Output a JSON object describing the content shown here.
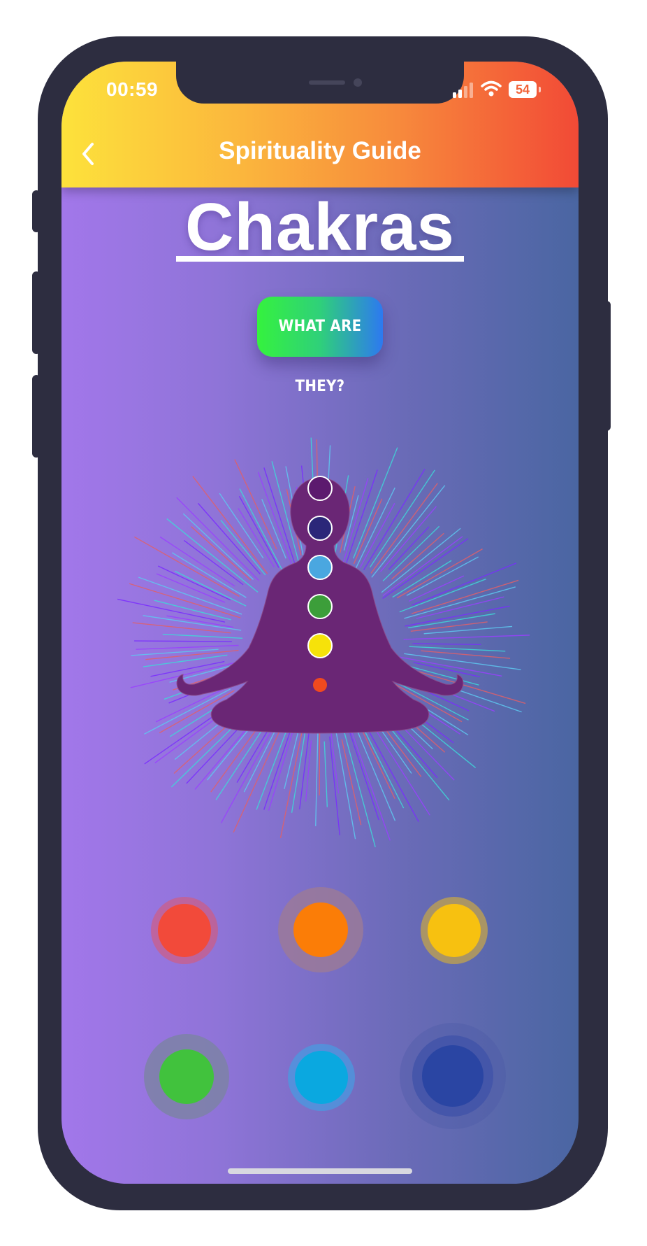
{
  "status_bar": {
    "time": "00:59",
    "battery": "54",
    "signal_icon": "cellular-signal-icon",
    "wifi_icon": "wifi-icon"
  },
  "header": {
    "title": "Spirituality Guide",
    "back_icon": "chevron-left-icon"
  },
  "main": {
    "heading": "Chakras",
    "what_button_label": "WHAT ARE THEY?",
    "figure_chakra_colors": [
      "#5c1a6e",
      "#2b2779",
      "#4aa7e0",
      "#3c9e3a",
      "#f6e20a",
      "#f04a1f"
    ]
  },
  "chakra_buttons": [
    {
      "name": "root",
      "color": "#f24a3a",
      "halo": "#e0566a"
    },
    {
      "name": "sacral",
      "color": "#fb7d07",
      "halo": "#9c7a96"
    },
    {
      "name": "solar-plexus",
      "color": "#f7c110",
      "halo": "#b39a5c"
    },
    {
      "name": "heart",
      "color": "#41c23d",
      "halo": "#7d82a6"
    },
    {
      "name": "throat",
      "color": "#0aa8e0",
      "halo": "#4a9ae0"
    },
    {
      "name": "third-eye",
      "color": "#2a45a3",
      "halo": "#3f52a8"
    }
  ],
  "colors": {
    "header_gradient_start": "#fde23b",
    "header_gradient_end": "#f24a36",
    "background_start": "#a277ea",
    "background_end": "#4a66a2",
    "figure": "#6a2675"
  }
}
